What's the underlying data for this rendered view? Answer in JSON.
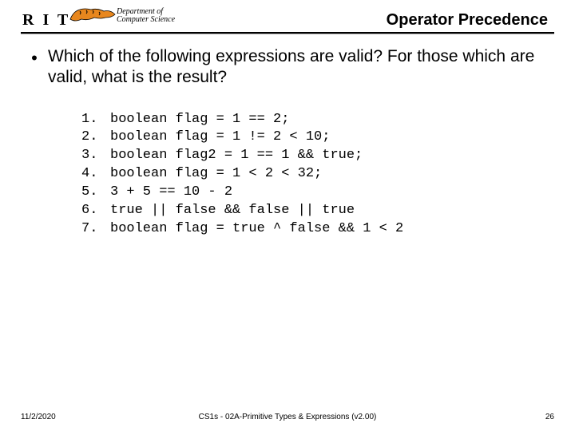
{
  "header": {
    "institution": "R I T",
    "dept_line1": "Department of",
    "dept_line2": "Computer Science",
    "title": "Operator Precedence"
  },
  "body": {
    "bullet": "•",
    "question": "Which of the following expressions are valid?  For those which are valid, what is the result?",
    "items": [
      {
        "n": "1.",
        "code": "boolean flag = 1 == 2;"
      },
      {
        "n": "2.",
        "code": "boolean flag = 1 != 2 < 10;"
      },
      {
        "n": "3.",
        "code": "boolean flag2 = 1 == 1 && true;"
      },
      {
        "n": "4.",
        "code": "boolean flag = 1 < 2 < 32;"
      },
      {
        "n": "5.",
        "code": "3 + 5 == 10 - 2"
      },
      {
        "n": "6.",
        "code": "true || false && false || true"
      },
      {
        "n": "7.",
        "code": "boolean flag = true ^ false && 1 < 2"
      }
    ]
  },
  "footer": {
    "date": "11/2/2020",
    "center": "CS1s - 02A-Primitive Types & Expressions (v2.00)",
    "page": "26"
  }
}
